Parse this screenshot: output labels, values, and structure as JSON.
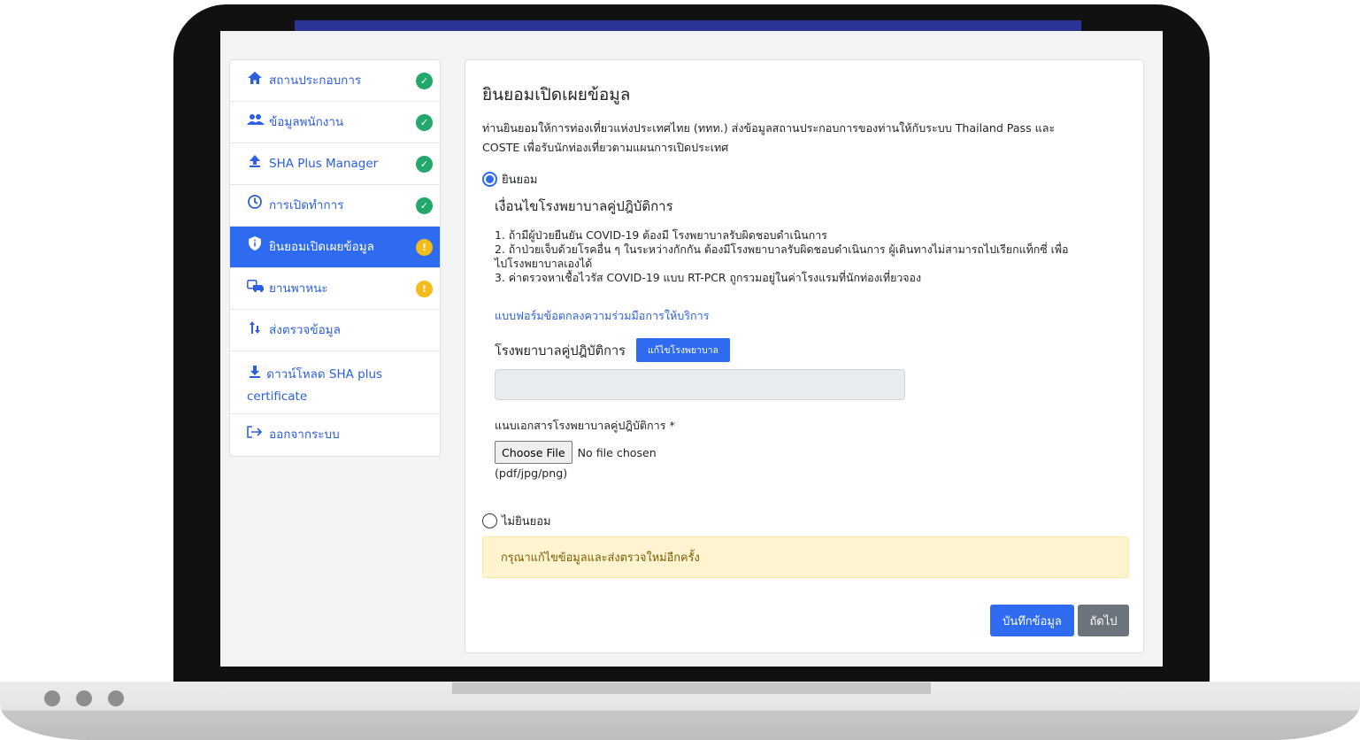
{
  "sidebar": {
    "items": [
      {
        "label": "สถานประกอบการ",
        "icon": "home-icon",
        "status": "done"
      },
      {
        "label": "ข้อมูลพนักงาน",
        "icon": "users-icon",
        "status": "done"
      },
      {
        "label": "SHA Plus Manager",
        "icon": "upload-arrow-icon",
        "status": "done"
      },
      {
        "label": "การเปิดทำการ",
        "icon": "clock-icon",
        "status": "done"
      },
      {
        "label": "ยินยอมเปิดเผยข้อมูล",
        "icon": "shield-icon",
        "status": "warning",
        "active": true
      },
      {
        "label": "ยานพาหนะ",
        "icon": "vehicle-icon",
        "status": "warning"
      },
      {
        "label": "ส่งตรวจข้อมูล",
        "icon": "sort-arrows-icon"
      },
      {
        "label_line1": "ดาวน์โหลด SHA plus",
        "label_line2": "certificate",
        "icon": "download-icon"
      },
      {
        "label": "ออกจากระบบ",
        "icon": "logout-icon"
      }
    ]
  },
  "main": {
    "title": "ยินยอมเปิดเผยข้อมูล",
    "intro_line1": "ท่านยินยอมให้การท่องเที่ยวแห่งประเทศไทย (ททท.) ส่งข้อมูลสถานประกอบการของท่านให้กับระบบ Thailand Pass และ",
    "intro_line2": "COSTE เพื่อรับนักท่องเที่ยวตามแผนการเปิดประเทศ",
    "consent_label": "ยินยอม",
    "condition_title": "เงื่อนไขโรงพยาบาลคู่ปฎิบัติการ",
    "conditions": [
      "1. ถ้ามีผู้ป่วยยืนยัน COVID-19 ต้องมี โรงพยาบาลรับผิดชอบดำเนินการ",
      "2. ถ้าป่วยเจ็บด้วยโรคอื่น ๆ ในระหว่างกักกัน ต้องมีโรงพยาบาลรับผิดชอบดำเนินการ ผู้เดินทางไม่สามารถไปเรียกแท็กซี่ เพื่อ",
      "ไปโรงพยาบาลเองได้",
      "3. ค่าตรวจหาเชื้อไวรัส COVID-19 แบบ RT-PCR ถูกรวมอยู่ในค่าโรงแรมที่นักท่องเที่ยวจอง"
    ],
    "form_link": "แบบฟอร์มข้อตกลงความร่วมมือการให้บริการ",
    "hospital_label": "โรงพยาบาลคู่ปฎิบัติการ",
    "edit_hospital_button": "แก้ไขโรงพยาบาล",
    "hospital_value": "",
    "document_label": "แนบเอกสารโรงพยาบาลคู่ปฎิบัติการ *",
    "choose_file_button": "Choose File",
    "file_status": "No file chosen",
    "file_hint": "(pdf/jpg/png)",
    "decline_label": "ไม่ยินยอม",
    "alert_text": "กรุณาแก้ไขข้อมูลและส่งตรวจใหม่อีกครั้ง",
    "save_button": "บันทึกข้อมูล",
    "next_button": "ถัดไป"
  },
  "colors": {
    "primary": "#2f6bf0",
    "success": "#23a86b",
    "warning": "#f2bc1b",
    "alert_bg": "#fff4cf",
    "topbar": "#2b3398"
  }
}
